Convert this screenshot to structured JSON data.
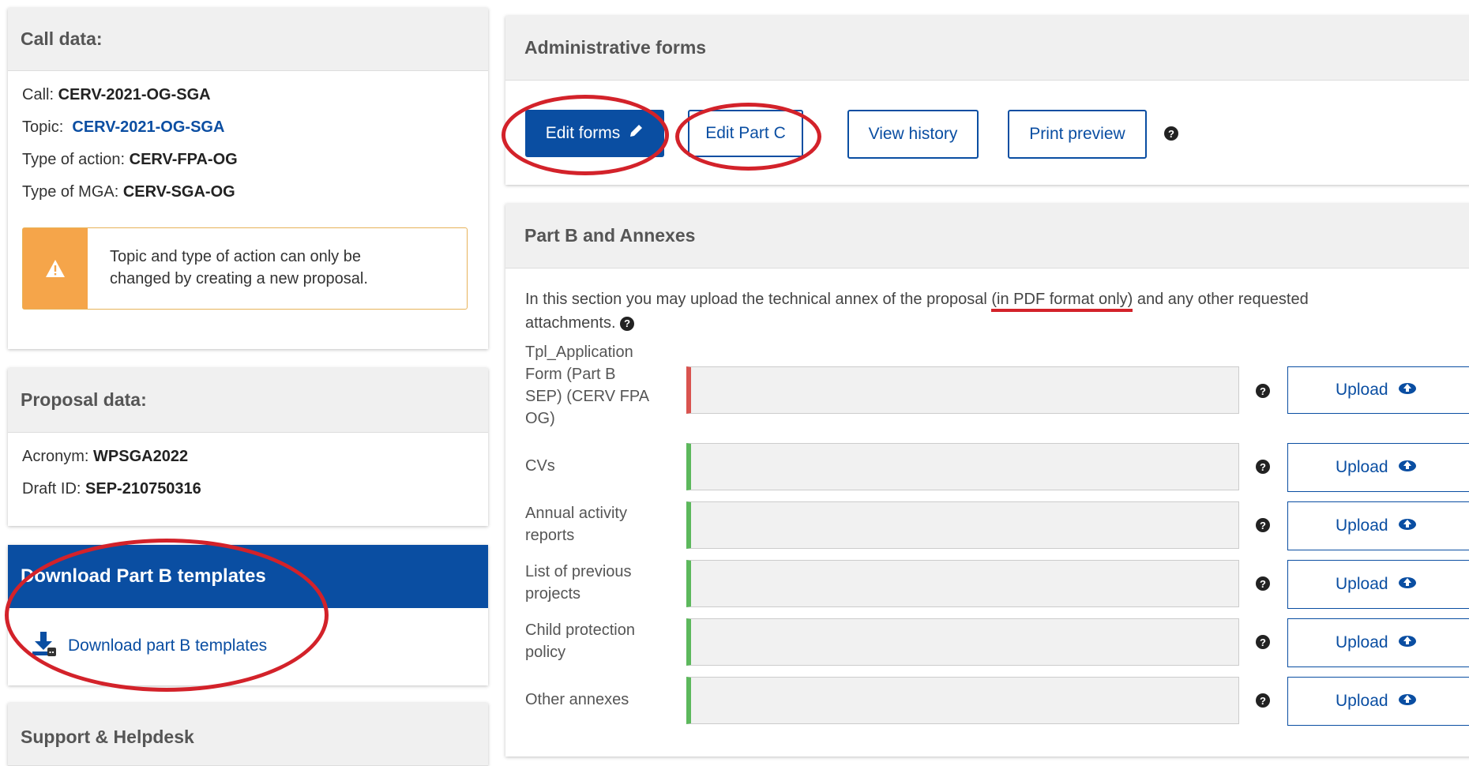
{
  "call_panel": {
    "title": "Call data:",
    "call_label": "Call:",
    "call_value": "CERV-2021-OG-SGA",
    "topic_label": "Topic:",
    "topic_value": "CERV-2021-OG-SGA",
    "type_action_label": "Type of action:",
    "type_action_value": "CERV-FPA-OG",
    "type_mga_label": "Type of MGA:",
    "type_mga_value": "CERV-SGA-OG",
    "warning_line1": "Topic and type of action can only be",
    "warning_line2": "changed by creating a new proposal."
  },
  "proposal_panel": {
    "title": "Proposal data:",
    "acronym_label": "Acronym:",
    "acronym_value": "WPSGA2022",
    "draft_label": "Draft ID:",
    "draft_value": "SEP-210750316"
  },
  "download_panel": {
    "title": "Download Part B templates",
    "link": "Download part B templates"
  },
  "support_panel": {
    "title": "Support & Helpdesk"
  },
  "admin_panel": {
    "title": "Administrative forms",
    "edit_forms": "Edit forms",
    "edit_part_c": "Edit Part C",
    "view_history": "View history",
    "print_preview": "Print preview"
  },
  "partb_panel": {
    "title": "Part B and Annexes",
    "intro_before": "In this section you may upload the technical annex of the proposal ",
    "intro_highlight": "(in PDF format only)",
    "intro_after": " and any other requested",
    "intro_line2": "attachments.",
    "upload_label": "Upload",
    "rows": [
      {
        "label": "Tpl_Application Form (Part B SEP) (CERV FPA OG)"
      },
      {
        "label": "CVs"
      },
      {
        "label": "Annual activity reports"
      },
      {
        "label": "List of previous projects"
      },
      {
        "label": "Child protection policy"
      },
      {
        "label": "Other annexes"
      }
    ]
  },
  "colors": {
    "brand_blue": "#0a4ea2",
    "warning_orange": "#f5a54a",
    "ok_green": "#5cb85c",
    "error_red": "#d9534f",
    "annotation_red": "#d3222a"
  },
  "icons": [
    "warning-icon",
    "pencil-icon",
    "question-icon",
    "cloud-upload-icon",
    "download-icon"
  ]
}
